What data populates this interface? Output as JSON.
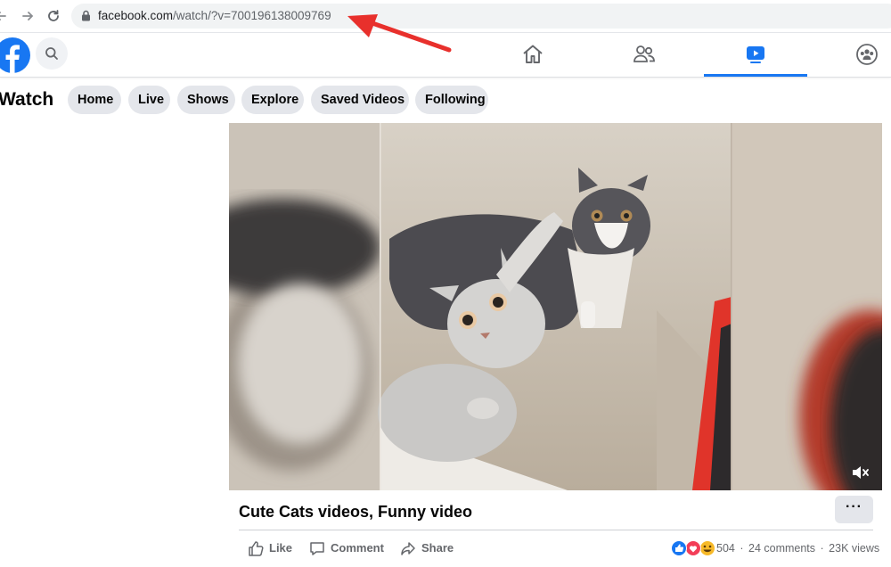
{
  "browser": {
    "url_host": "facebook.com",
    "url_path": "/watch/?v=700196138009769"
  },
  "annotation": {
    "color": "#e8302c"
  },
  "topnav": {
    "accent": "#1877f2",
    "icons": [
      "home-icon",
      "friends-icon",
      "watch-icon",
      "groups-icon"
    ],
    "active": "watch"
  },
  "watch": {
    "title": "Watch",
    "tabs": [
      "Home",
      "Live",
      "Shows",
      "Explore",
      "Saved Videos",
      "Following"
    ]
  },
  "post": {
    "title": "Cute Cats videos, Funny video",
    "more_label": "···",
    "actions": {
      "like": "Like",
      "comment": "Comment",
      "share": "Share"
    },
    "reaction_count": "504",
    "comments": "24 comments",
    "views": "23K views",
    "separator": "·"
  }
}
